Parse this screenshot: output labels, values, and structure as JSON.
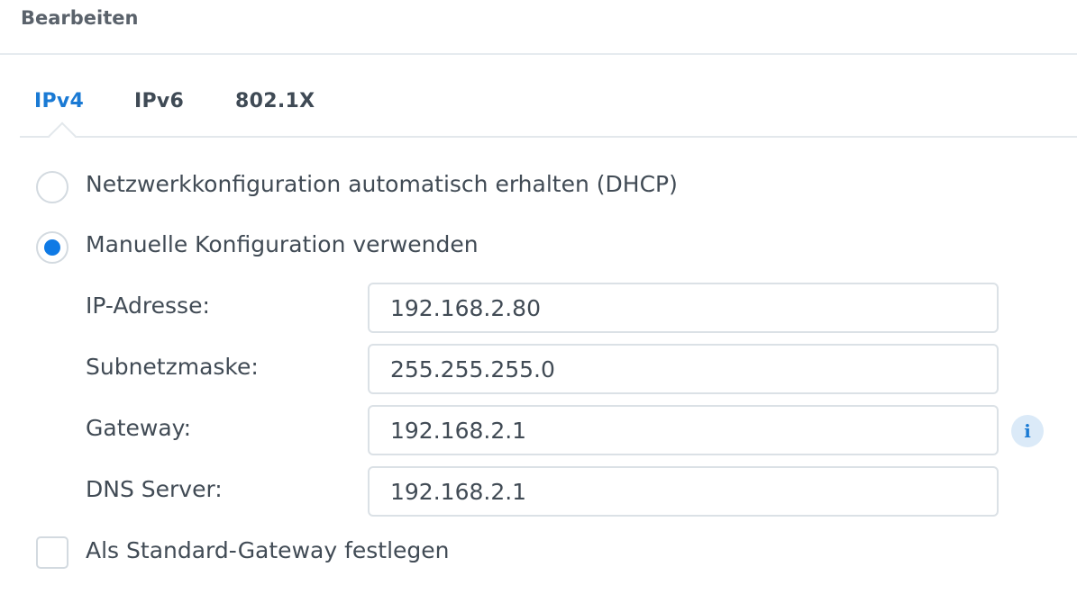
{
  "header": {
    "title": "Bearbeiten"
  },
  "tabs": [
    {
      "label": "IPv4",
      "active": true
    },
    {
      "label": "IPv6",
      "active": false
    },
    {
      "label": "802.1X",
      "active": false
    }
  ],
  "options": {
    "dhcp": {
      "label": "Netzwerkkonfiguration automatisch erhalten (DHCP)",
      "selected": false
    },
    "manual": {
      "label": "Manuelle Konfiguration verwenden",
      "selected": true
    }
  },
  "fields": {
    "ip": {
      "label": "IP-Adresse:",
      "value": "192.168.2.80"
    },
    "subnet": {
      "label": "Subnetzmaske:",
      "value": "255.255.255.0"
    },
    "gateway": {
      "label": "Gateway:",
      "value": "192.168.2.1"
    },
    "dns": {
      "label": "DNS Server:",
      "value": "192.168.2.1"
    }
  },
  "info_icon": {
    "glyph": "i",
    "name": "info-icon"
  },
  "default_gateway": {
    "label": "Als Standard-Gateway festlegen",
    "checked": false
  },
  "colors": {
    "accent": "#1a7ad4",
    "radio_selected": "#0f7ae5",
    "text": "#414b55"
  }
}
